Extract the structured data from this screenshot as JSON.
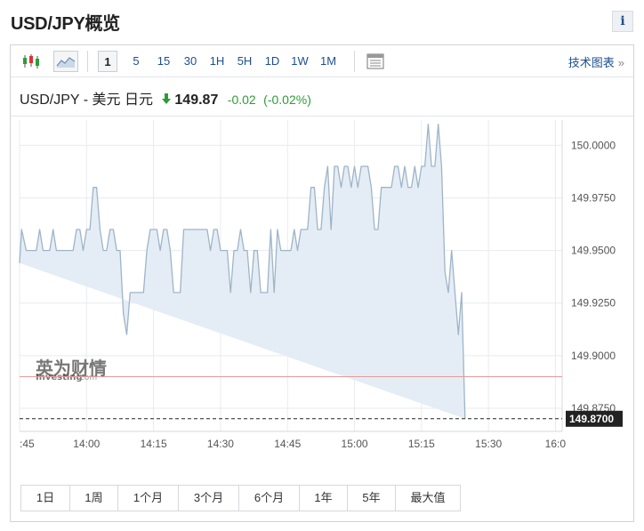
{
  "page": {
    "title": "USD/JPY概览",
    "info_label": "i"
  },
  "toolbar": {
    "timeframes": [
      "1",
      "5",
      "15",
      "30",
      "1H",
      "5H",
      "1D",
      "1W",
      "1M"
    ],
    "active_timeframe": "1",
    "tech_chart_label": "技术图表",
    "tech_chart_chevron": "»",
    "icons": [
      "candlestick-icon",
      "area-chart-icon",
      "table-view-icon"
    ]
  },
  "quote": {
    "name": "USD/JPY - 美元 日元",
    "price": "149.87",
    "change": "-0.02",
    "change_pct": "(-0.02%)",
    "direction": "down"
  },
  "watermark": {
    "brand_cn": "英为财情",
    "brand_en": "Investing",
    "brand_suffix": ".com"
  },
  "colors": {
    "line": "#9fb4c8",
    "fill": "#e4edf5",
    "grid": "#e8ebee",
    "ref_line": "#e59a9a",
    "current_line": "#222222",
    "price_tag_bg": "#222222",
    "up": "#2e9c36",
    "down": "#2e9c36",
    "link": "#1d4f91"
  },
  "chart_data": {
    "type": "area",
    "x_tick_labels": [
      ":45",
      "14:00",
      "14:15",
      "14:30",
      "14:45",
      "15:00",
      "15:15",
      "15:30",
      "16:0"
    ],
    "y_tick_labels": [
      "150.0000",
      "149.9750",
      "149.9500",
      "149.9250",
      "149.9000",
      "149.8750"
    ],
    "y_ticks": [
      150.0,
      149.975,
      149.95,
      149.925,
      149.9,
      149.875
    ],
    "ylim": [
      149.864,
      150.012
    ],
    "x_range_minutes": [
      0,
      81
    ],
    "x_tick_positions": [
      0,
      10,
      20,
      30,
      40,
      50,
      60,
      70,
      80
    ],
    "grid": true,
    "reference_line": 149.89,
    "current_value": 149.87,
    "current_value_label": "149.8700",
    "x": [
      0,
      0.3,
      1,
      1.5,
      2,
      2.5,
      3,
      3.5,
      4,
      4.5,
      5,
      5.5,
      6,
      6.5,
      7,
      7.5,
      8,
      8.5,
      9,
      9.5,
      10,
      10.5,
      11,
      11.5,
      12,
      12.5,
      13,
      13.5,
      14,
      14.5,
      15,
      15.5,
      16,
      16.5,
      17,
      17.5,
      18,
      18.5,
      19,
      19.5,
      20,
      20.5,
      21,
      21.5,
      22,
      22.5,
      23,
      23.5,
      24,
      24.5,
      25,
      25.5,
      26,
      26.5,
      27,
      27.5,
      28,
      28.5,
      29,
      29.5,
      30,
      30.5,
      31,
      31.5,
      32,
      32.5,
      33,
      33.5,
      34,
      34.5,
      35,
      35.5,
      36,
      36.5,
      37,
      37.5,
      38,
      38.5,
      39,
      39.5,
      40,
      40.5,
      41,
      41.5,
      42,
      42.5,
      43,
      43.5,
      44,
      44.5,
      45,
      45.5,
      46,
      46.5,
      47,
      47.5,
      48,
      48.5,
      49,
      49.5,
      50,
      50.5,
      51,
      51.5,
      52,
      52.5,
      53,
      53.5,
      54,
      54.5,
      55,
      55.5,
      56,
      56.5,
      57,
      57.5,
      58,
      58.5,
      59,
      59.5,
      60,
      60.5,
      61,
      61.5,
      62,
      62.5,
      63,
      63.5,
      64,
      64.5,
      65,
      65.5,
      66,
      66.5,
      67,
      67.5,
      68,
      68.5,
      69,
      69.5,
      70,
      70.5,
      71,
      71.5,
      72,
      72.5,
      73,
      73.5,
      74,
      74.5,
      75,
      75.5,
      76,
      76.5,
      77,
      77.5,
      78,
      78.5,
      79,
      79.5,
      80,
      80.5
    ],
    "y": [
      149.944,
      149.96,
      149.95,
      149.95,
      149.95,
      149.95,
      149.96,
      149.95,
      149.95,
      149.95,
      149.96,
      149.95,
      149.95,
      149.95,
      149.95,
      149.95,
      149.95,
      149.96,
      149.96,
      149.95,
      149.96,
      149.96,
      149.98,
      149.98,
      149.96,
      149.95,
      149.95,
      149.96,
      149.96,
      149.95,
      149.95,
      149.92,
      149.91,
      149.93,
      149.93,
      149.93,
      149.93,
      149.93,
      149.95,
      149.96,
      149.96,
      149.96,
      149.95,
      149.96,
      149.96,
      149.95,
      149.93,
      149.93,
      149.93,
      149.96,
      149.96,
      149.96,
      149.96,
      149.96,
      149.96,
      149.96,
      149.96,
      149.95,
      149.96,
      149.96,
      149.95,
      149.95,
      149.95,
      149.93,
      149.95,
      149.95,
      149.96,
      149.95,
      149.95,
      149.93,
      149.95,
      149.95,
      149.93,
      149.93,
      149.93,
      149.96,
      149.93,
      149.96,
      149.95,
      149.95,
      149.95,
      149.95,
      149.96,
      149.95,
      149.96,
      149.96,
      149.96,
      149.98,
      149.98,
      149.96,
      149.96,
      149.98,
      149.99,
      149.96,
      149.99,
      149.99,
      149.98,
      149.99,
      149.99,
      149.98,
      149.99,
      149.98,
      149.99,
      149.99,
      149.99,
      149.98,
      149.96,
      149.96,
      149.98,
      149.98,
      149.98,
      149.98,
      149.99,
      149.99,
      149.98,
      149.99,
      149.98,
      149.98,
      149.99,
      149.98,
      149.99,
      149.99,
      150.01,
      149.99,
      149.99,
      150.01,
      149.99,
      149.94,
      149.93,
      149.95,
      149.93,
      149.91,
      149.93,
      149.87
    ]
  },
  "ranges": [
    "1日",
    "1周",
    "1个月",
    "3个月",
    "6个月",
    "1年",
    "5年",
    "最大值"
  ]
}
